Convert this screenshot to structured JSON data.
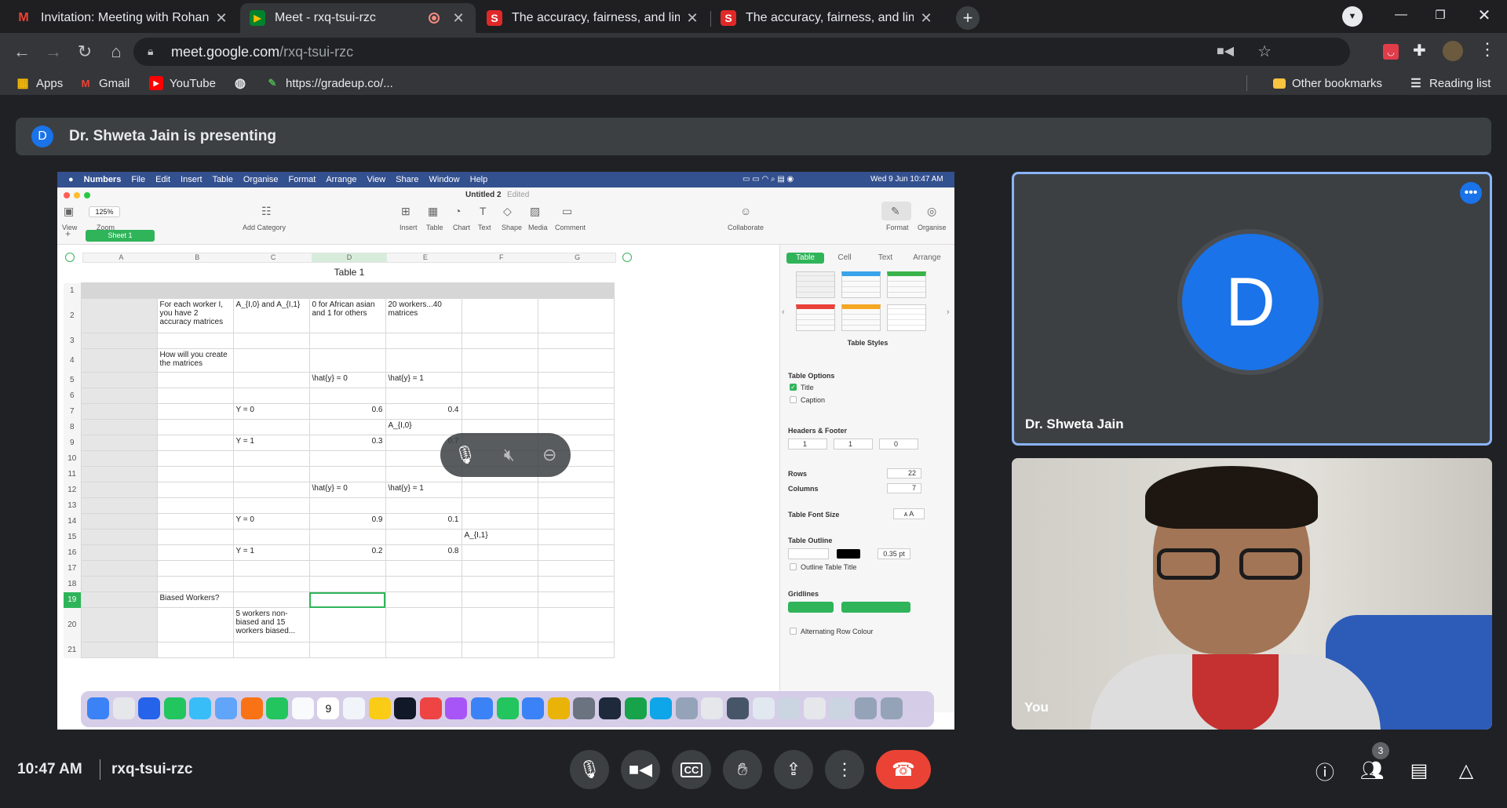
{
  "tabs": [
    {
      "label": "Invitation: Meeting with Rohan @",
      "favicon": "gmail-icon",
      "color": "#ea4335"
    },
    {
      "label": "Meet - rxq-tsui-rzc",
      "favicon": "meet-icon",
      "color": "#00832d"
    },
    {
      "label": "The accuracy, fairness, and limits",
      "favicon": "scribd-icon",
      "color": "#e12828"
    },
    {
      "label": "The accuracy, fairness, and limits",
      "favicon": "scribd-icon",
      "color": "#e12828"
    }
  ],
  "address": {
    "host": "meet.google.com",
    "path": "/rxq-tsui-rzc"
  },
  "bookmarks": {
    "apps": "Apps",
    "gmail": "Gmail",
    "youtube": "YouTube",
    "gradeup": "https://gradeup.co/...",
    "other": "Other bookmarks",
    "reading": "Reading list"
  },
  "meet": {
    "presenter_initial": "D",
    "presenting_text": "Dr. Shweta Jain is presenting",
    "participant_name": "Dr. Shweta Jain",
    "self_label": "You",
    "time": "10:47 AM",
    "meeting_code": "rxq-tsui-rzc",
    "people_count": "3",
    "accent": "#1a73e8",
    "end_call_color": "#ea4335"
  },
  "mac": {
    "menu": [
      "Numbers",
      "File",
      "Edit",
      "Insert",
      "Table",
      "Organise",
      "Format",
      "Arrange",
      "View",
      "Share",
      "Window",
      "Help"
    ],
    "clock": "Wed 9 Jun  10:47 AM",
    "doc_title": "Untitled 2",
    "doc_status": "Edited",
    "zoom": "125%",
    "tool_labels": {
      "view": "View",
      "zoom": "Zoom",
      "add_category": "Add Category",
      "insert": "Insert",
      "table": "Table",
      "chart": "Chart",
      "text": "Text",
      "shape": "Shape",
      "media": "Media",
      "comment": "Comment",
      "collaborate": "Collaborate",
      "format": "Format",
      "organise": "Organise"
    },
    "sheet_tab": "Sheet 1",
    "columns": [
      "A",
      "B",
      "C",
      "D",
      "E",
      "F",
      "G"
    ],
    "table_title": "Table 1"
  },
  "table_rows": [
    {
      "n": "1",
      "cells": [
        "",
        "",
        "",
        "",
        "",
        "",
        ""
      ]
    },
    {
      "n": "2",
      "cells": [
        "",
        "For each worker I, you have 2 accuracy matrices",
        "A_{I,0} and A_{I,1}",
        "0 for African asian and 1 for others",
        "20 workers...40 matrices",
        "",
        ""
      ]
    },
    {
      "n": "3",
      "cells": [
        "",
        "",
        "",
        "",
        "",
        "",
        ""
      ]
    },
    {
      "n": "4",
      "cells": [
        "",
        "How will you create the matrices",
        "",
        "",
        "",
        "",
        ""
      ]
    },
    {
      "n": "5",
      "cells": [
        "",
        "",
        "",
        "\\hat{y} = 0",
        "\\hat{y} = 1",
        "",
        ""
      ]
    },
    {
      "n": "6",
      "cells": [
        "",
        "",
        "",
        "",
        "",
        "",
        ""
      ]
    },
    {
      "n": "7",
      "cells": [
        "",
        "",
        "Y = 0",
        "0.6",
        "0.4",
        "",
        ""
      ]
    },
    {
      "n": "8",
      "cells": [
        "",
        "",
        "",
        "",
        "A_{I,0}",
        "",
        ""
      ]
    },
    {
      "n": "9",
      "cells": [
        "",
        "",
        "Y = 1",
        "0.3",
        "0.7",
        "",
        ""
      ]
    },
    {
      "n": "10",
      "cells": [
        "",
        "",
        "",
        "",
        "",
        "",
        ""
      ]
    },
    {
      "n": "11",
      "cells": [
        "",
        "",
        "",
        "",
        "",
        "",
        ""
      ]
    },
    {
      "n": "12",
      "cells": [
        "",
        "",
        "",
        "\\hat{y} = 0",
        "\\hat{y} = 1",
        "",
        ""
      ]
    },
    {
      "n": "13",
      "cells": [
        "",
        "",
        "",
        "",
        "",
        "",
        ""
      ]
    },
    {
      "n": "14",
      "cells": [
        "",
        "",
        "Y = 0",
        "0.9",
        "0.1",
        "",
        ""
      ]
    },
    {
      "n": "15",
      "cells": [
        "",
        "",
        "",
        "",
        "",
        "A_{I,1}",
        ""
      ]
    },
    {
      "n": "16",
      "cells": [
        "",
        "",
        "Y = 1",
        "0.2",
        "0.8",
        "",
        ""
      ]
    },
    {
      "n": "17",
      "cells": [
        "",
        "",
        "",
        "",
        "",
        "",
        ""
      ]
    },
    {
      "n": "18",
      "cells": [
        "",
        "",
        "",
        "",
        "",
        "",
        ""
      ]
    },
    {
      "n": "19",
      "cells": [
        "",
        "Biased Workers?",
        "",
        "",
        "",
        "",
        ""
      ]
    },
    {
      "n": "20",
      "cells": [
        "",
        "",
        "5 workers non-biased and 15 workers biased...",
        "",
        "",
        "",
        ""
      ]
    },
    {
      "n": "21",
      "cells": [
        "",
        "",
        "",
        "",
        "",
        "",
        ""
      ]
    }
  ],
  "inspector": {
    "tabs": [
      "Table",
      "Cell",
      "Text",
      "Arrange"
    ],
    "table_styles": "Table Styles",
    "table_options": "Table Options",
    "title_opt": "Title",
    "caption_opt": "Caption",
    "headers_footer": "Headers & Footer",
    "hf_values": [
      "1",
      "1",
      "0"
    ],
    "rows_label": "Rows",
    "rows_value": "22",
    "columns_label": "Columns",
    "columns_value": "7",
    "font_size_label": "Table Font Size",
    "outline_label": "Table Outline",
    "outline_value": "0.35 pt",
    "outline_title": "Outline Table Title",
    "gridlines": "Gridlines",
    "alternating": "Alternating Row Colour",
    "dock_calendar_day": "9"
  }
}
